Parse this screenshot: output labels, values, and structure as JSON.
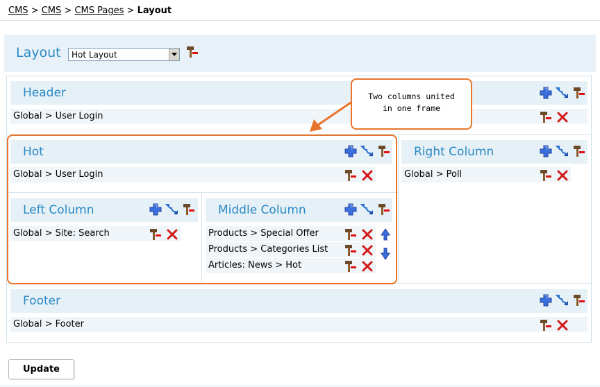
{
  "breadcrumb": {
    "items": [
      "CMS",
      "CMS",
      "CMS Pages"
    ],
    "separator": ">",
    "current": "Layout"
  },
  "layout": {
    "title": "Layout",
    "selected": "Hot Layout"
  },
  "callout": {
    "line1": "Two columns united",
    "line2": "in one frame"
  },
  "sections": {
    "header": {
      "title": "Header",
      "items": [
        "Global > User Login"
      ]
    },
    "hot": {
      "title": "Hot",
      "items": [
        "Global > User Login"
      ]
    },
    "left": {
      "title": "Left Column",
      "items": [
        "Global > Site: Search"
      ]
    },
    "middle": {
      "title": "Middle Column",
      "items": [
        "Products > Special Offer",
        "Products > Categories List",
        "Articles: News > Hot"
      ]
    },
    "right": {
      "title": "Right Column",
      "items": [
        "Global > Poll"
      ]
    },
    "footer": {
      "title": "Footer",
      "items": [
        "Global > Footer"
      ]
    }
  },
  "buttons": {
    "update": "Update"
  },
  "colors": {
    "accent": "#2a8ac4",
    "callout": "#e8732a",
    "delete": "#cc1111",
    "add": "#2b5fd9"
  },
  "icons": [
    "add-icon",
    "move-icon",
    "edit-icon",
    "delete-icon",
    "arrow-up-icon",
    "arrow-down-icon"
  ]
}
